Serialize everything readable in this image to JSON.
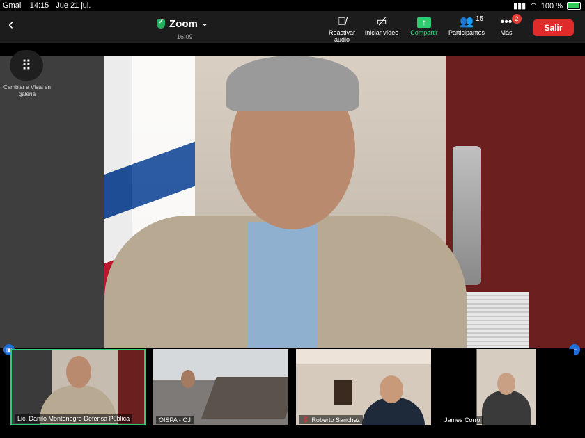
{
  "status_bar": {
    "back_app": "Gmail",
    "time": "14:15",
    "date": "Jue 21 jul.",
    "battery": "100 %"
  },
  "toolbar": {
    "title": "Zoom",
    "duration": "16:09",
    "buttons": [
      {
        "label": "Reactivar audio",
        "icon": "mic-off-icon"
      },
      {
        "label": "Iniciar vídeo",
        "icon": "video-off-icon"
      },
      {
        "label": "Compartir",
        "icon": "share-up-icon"
      },
      {
        "label": "Participantes",
        "icon": "people-icon"
      },
      {
        "label": "Más",
        "icon": "more-icon"
      }
    ],
    "participant_count": "15",
    "more_badge": "2",
    "leave_label": "Salir"
  },
  "gallery": {
    "label": "Cambiar a Vista en galería"
  },
  "participants": [
    {
      "name": "Lic. Danilo Montenegro-Defensa Pública",
      "muted": false,
      "active": true
    },
    {
      "name": "OISPA - OJ",
      "muted": false,
      "active": false
    },
    {
      "name": "Roberto Sanchez",
      "muted": true,
      "active": false
    },
    {
      "name": "James Corro",
      "muted": false,
      "active": false
    }
  ],
  "colors": {
    "accent_green": "#2ecc71",
    "leave_red": "#e02b2b",
    "toolbar_bg": "#1c1c1c"
  }
}
